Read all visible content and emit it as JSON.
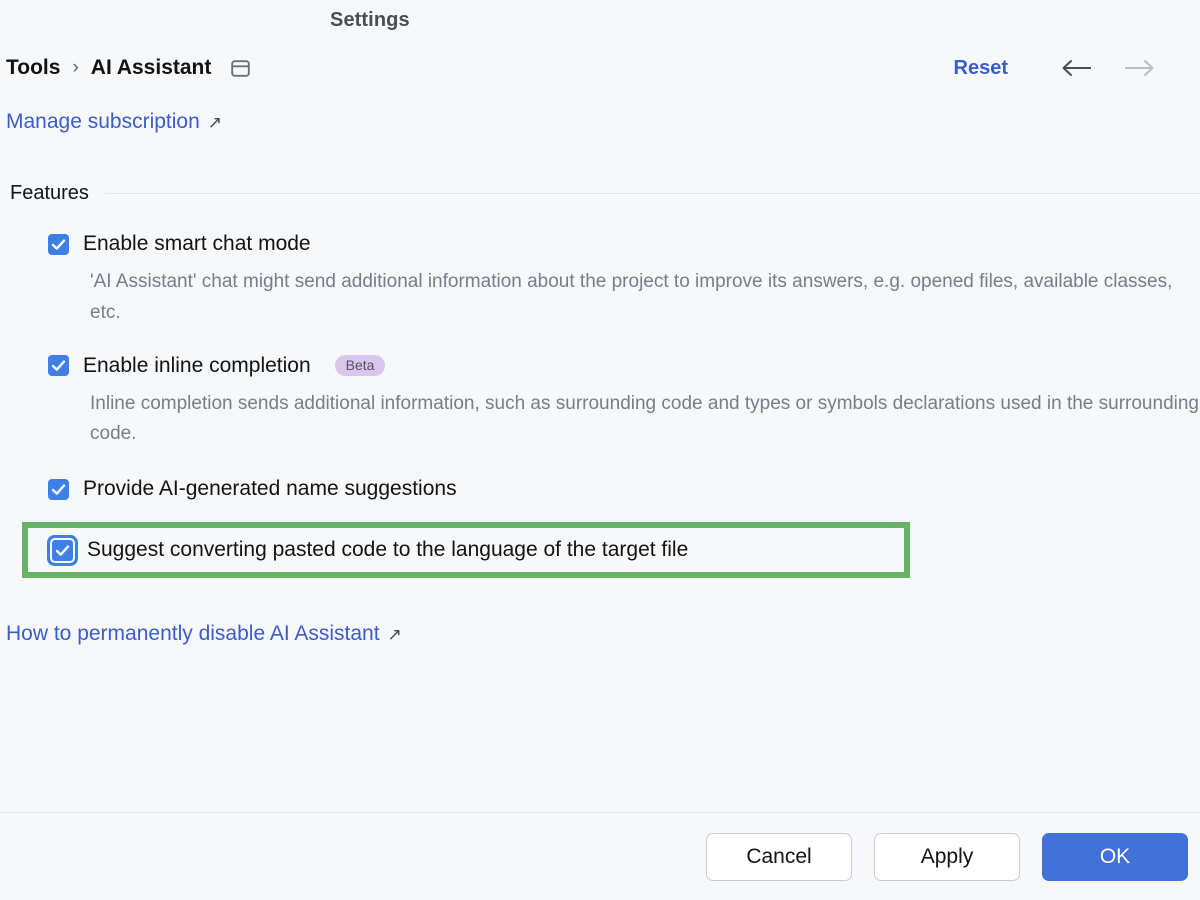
{
  "window": {
    "title": "Settings"
  },
  "breadcrumb": {
    "root": "Tools",
    "separator": "›",
    "current": "AI Assistant",
    "panel_icon": "window-panel-icon"
  },
  "header_actions": {
    "reset_label": "Reset",
    "back_icon": "arrow-left-icon",
    "forward_icon": "arrow-right-icon",
    "back_enabled": true,
    "forward_enabled": false
  },
  "links": {
    "manage_subscription": "Manage subscription",
    "external_icon": "↗",
    "how_to_disable": "How to permanently disable AI Assistant"
  },
  "features": {
    "section_label": "Features",
    "options": [
      {
        "label": "Enable smart chat mode",
        "checked": true,
        "badge": null,
        "description": "'AI Assistant' chat might send additional information about the project to improve its answers, e.g. opened files, available classes, etc.",
        "highlighted": false,
        "focused": false
      },
      {
        "label": "Enable inline completion",
        "checked": true,
        "badge": "Beta",
        "description": "Inline completion sends additional information, such as surrounding code and types or symbols declarations used in the surrounding code.",
        "highlighted": false,
        "focused": false
      },
      {
        "label": "Provide AI-generated name suggestions",
        "checked": true,
        "badge": null,
        "description": null,
        "highlighted": false,
        "focused": false
      },
      {
        "label": "Suggest converting pasted code to the language of the target file",
        "checked": true,
        "badge": null,
        "description": null,
        "highlighted": true,
        "focused": true
      }
    ]
  },
  "footer": {
    "cancel_label": "Cancel",
    "apply_label": "Apply",
    "ok_label": "OK"
  },
  "colors": {
    "accent_blue": "#4272d8",
    "link_blue": "#3a5ccc",
    "checkbox_blue": "#3f7fe8",
    "highlight_green": "#67b36a",
    "badge_purple": "#d9c6ee",
    "description_gray": "#787c8c",
    "background": "#f7f8fa"
  }
}
